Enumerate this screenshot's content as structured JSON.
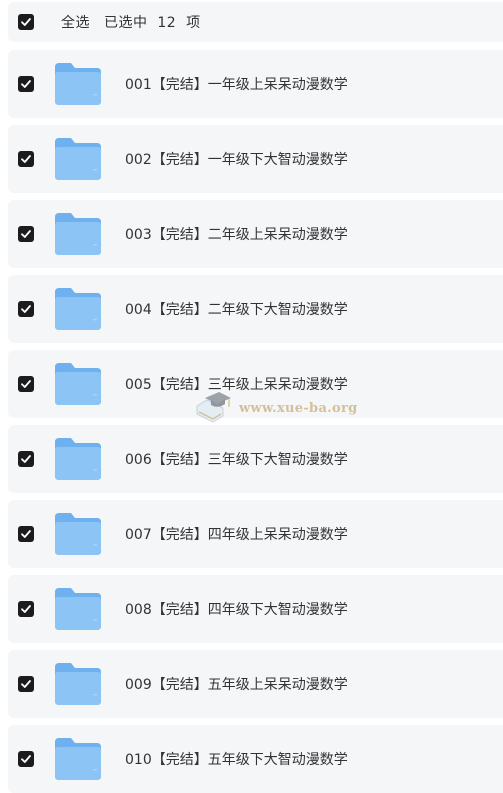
{
  "header": {
    "select_all_label": "全选",
    "selected_summary": "已选中  12  项",
    "all_checked": true
  },
  "files": [
    {
      "title": "001【完结】一年级上呆呆动漫数学",
      "checked": true
    },
    {
      "title": "002【完结】一年级下大智动漫数学",
      "checked": true
    },
    {
      "title": "003【完结】二年级上呆呆动漫数学",
      "checked": true
    },
    {
      "title": "004【完结】二年级下大智动漫数学",
      "checked": true
    },
    {
      "title": "005【完结】三年级上呆呆动漫数学",
      "checked": true
    },
    {
      "title": "006【完结】三年级下大智动漫数学",
      "checked": true
    },
    {
      "title": "007【完结】四年级上呆呆动漫数学",
      "checked": true
    },
    {
      "title": "008【完结】四年级下大智动漫数学",
      "checked": true
    },
    {
      "title": "009【完结】五年级上呆呆动漫数学",
      "checked": true
    },
    {
      "title": "010【完结】五年级下大智动漫数学",
      "checked": true
    }
  ],
  "icons": {
    "checkbox": "checkmark-icon",
    "folder": "folder-icon"
  },
  "colors": {
    "row_background": "#f5f6f8",
    "checkbox_fill": "#1c1c1e",
    "folder_front": "#8cc4f5",
    "folder_back": "#6fb1ee",
    "text": "#333333"
  },
  "watermark": {
    "text": "www.xue-ba.org"
  }
}
